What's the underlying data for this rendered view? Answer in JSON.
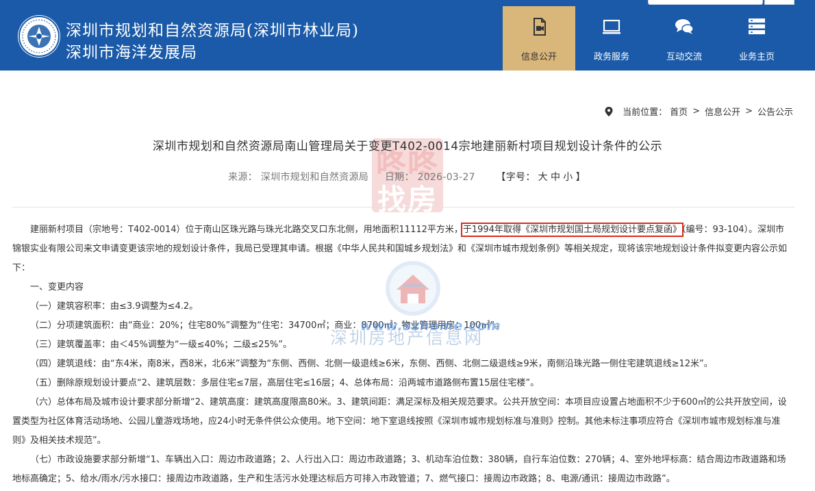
{
  "header": {
    "title_line1": "深圳市规划和自然资源局(深圳市林业局)",
    "title_line2": "深圳市海洋发展局",
    "nav": [
      {
        "label": "信息公开",
        "icon": "document-video-icon",
        "active": true
      },
      {
        "label": "政务服务",
        "icon": "monitor-icon",
        "active": false
      },
      {
        "label": "互动交流",
        "icon": "chat-bubbles-icon",
        "active": false
      },
      {
        "label": "业务主页",
        "icon": "server-stack-icon",
        "active": false
      }
    ]
  },
  "breadcrumb": {
    "prefix": "当前位置：",
    "items": [
      "首页",
      "信息公开",
      "公告公示"
    ],
    "separator": ">"
  },
  "article": {
    "title": "深圳市规划和自然资源局南山管理局关于变更T402-0014宗地建丽新村项目规划设计条件的公示",
    "meta": {
      "source_label": "来源：",
      "source": "深圳市规划和自然资源局",
      "date_label": "日期：",
      "date": "2026-03-27",
      "fontsize_prefix": "【字号：",
      "fontsize_options": [
        "大",
        "中",
        "小"
      ],
      "fontsize_suffix": "】"
    },
    "intro_before": "建丽新村项目（宗地号：T402-0014）位于南山区珠光路与珠光北路交叉口东北侧，用地面积11112平方米，",
    "intro_highlight": "于1994年取得《深圳市规划国土局规划设计要点复函》",
    "intro_after": "（编号：93-104）。深圳市锦银实业有限公司来文申请变更该宗地的规划设计条件，我局已受理其申请。根据《中华人民共和国城乡规划法》和《深圳市城市规划条例》等相关规定，现将该宗地规划设计条件拟变更内容公示如下：",
    "items": [
      "一、变更内容",
      "（一）建筑容积率：由≤3.9调整为≤4.2。",
      "（二）分项建筑面积：由“商业：20%；住宅80%”调整为“住宅：34700㎡；商业：8700㎡；物业管理用房：100㎡”。",
      "（三）建筑覆盖率：由＜45%调整为“一级≤40%；二级≤25%”。",
      "（四）建筑退线：由“东4米，南8米，西8米，北6米”调整为“东侧、西侧、北侧一级退线≥6米，东侧、西侧、北侧二级退线≥9米，南侧沿珠光路一侧住宅建筑退线≥12米”。",
      "（五）删除原规划设计要点“2、建筑层数：多层住宅≤7层，高层住宅≤16层；4、总体布局：沿两城市道路侧布置15层住宅楼”。",
      "（六）总体布局及城市设计要求部分新增“2、建筑高度：建筑高度限高80米。3、建筑间距：满足深标及相关规范要求。公共开放空间：本项目应设置占地面积不少于600㎡的公共开放空间，设置类型为社区体育活动场地、公园儿童游戏场地，应24小时无条件供公众使用。地下空间：地下室退线按照《深圳市城市规划标准与准则》控制。其他未标注事项应符合《深圳市城市规划标准与准则》及相关技术规范”。",
      "（七）市政设施要求部分新增“1、车辆出入口：周边市政道路；2、人行出入口：周边市政道路；3、机动车泊位数：380辆，自行车泊位数：270辆；4、室外地坪标高：结合周边市政道路和场地标高确定；5、给水/雨水/污水接口：接周边市政道路，生产和生活污水处理达标后方可排入市政管道；7、燃气接口：接周边市政路；8、电源/通讯：接周边市政路”。"
    ]
  },
  "watermarks": {
    "stamp_top": "咚咚",
    "stamp_bottom": "找房",
    "url": "www.szhome.com",
    "site_name": "深圳房地产信息网"
  },
  "colors": {
    "header_bg": "#1a5aa8",
    "nav_active_bg": "#d9b679",
    "highlight_border": "#d9291c"
  }
}
